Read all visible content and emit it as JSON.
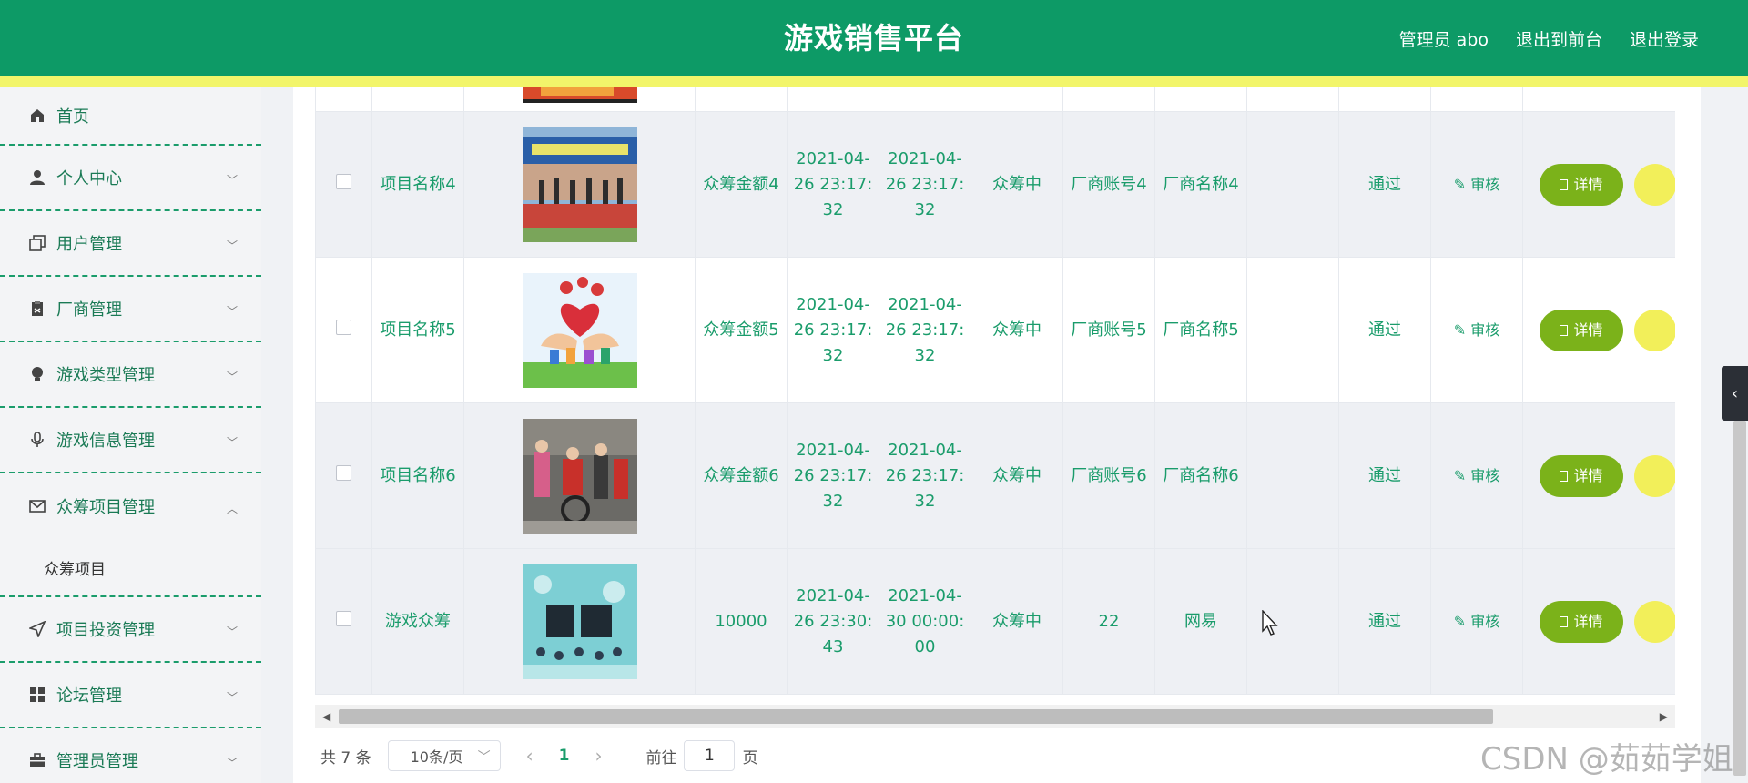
{
  "header": {
    "title": "游戏销售平台",
    "admin": "管理员 abo",
    "to_front": "退出到前台",
    "logout": "退出登录"
  },
  "sidebar": {
    "items": [
      {
        "label": "首页",
        "icon": "home-icon"
      },
      {
        "label": "个人中心",
        "icon": "user-icon"
      },
      {
        "label": "用户管理",
        "icon": "copy-icon"
      },
      {
        "label": "厂商管理",
        "icon": "clipboard-icon"
      },
      {
        "label": "游戏类型管理",
        "icon": "bulb-icon"
      },
      {
        "label": "游戏信息管理",
        "icon": "mic-icon"
      },
      {
        "label": "众筹项目管理",
        "icon": "mail-icon"
      },
      {
        "label": "项目投资管理",
        "icon": "navigation-icon"
      },
      {
        "label": "论坛管理",
        "icon": "grid-icon"
      },
      {
        "label": "管理员管理",
        "icon": "briefcase-icon"
      }
    ],
    "submenu_label": "众筹项目"
  },
  "table": {
    "rows": [
      {
        "name": "项目名称4",
        "amount": "众筹金额4",
        "start": "2021-04-26 23:17:32",
        "end": "2021-04-26 23:17:32",
        "status": "众筹中",
        "account": "厂商账号4",
        "vendor": "厂商名称4",
        "blank": "",
        "review": "通过",
        "audit": "审核",
        "detail": "详情",
        "image": "crowd-banner-image"
      },
      {
        "name": "项目名称5",
        "amount": "众筹金额5",
        "start": "2021-04-26 23:17:32",
        "end": "2021-04-26 23:17:32",
        "status": "众筹中",
        "account": "厂商账号5",
        "vendor": "厂商名称5",
        "blank": "",
        "review": "通过",
        "audit": "审核",
        "detail": "详情",
        "image": "hearts-hands-image"
      },
      {
        "name": "项目名称6",
        "amount": "众筹金额6",
        "start": "2021-04-26 23:17:32",
        "end": "2021-04-26 23:17:32",
        "status": "众筹中",
        "account": "厂商账号6",
        "vendor": "厂商名称6",
        "blank": "",
        "review": "通过",
        "audit": "审核",
        "detail": "详情",
        "image": "volunteers-image"
      },
      {
        "name": "游戏众筹",
        "amount": "10000",
        "start": "2021-04-26 23:30:43",
        "end": "2021-04-30 00:00:00",
        "status": "众筹中",
        "account": "22",
        "vendor": "网易",
        "blank": "",
        "review": "通过",
        "audit": "审核",
        "detail": "详情",
        "image": "crowdfunding-text-image"
      }
    ]
  },
  "pager": {
    "total": "共 7 条",
    "page_size": "10条/页",
    "current": "1",
    "goto_label": "前往",
    "goto_value": "1",
    "page_unit": "页"
  },
  "watermark": "CSDN @茹茹学姐",
  "colors": {
    "header": "#0d9a66",
    "accent_yellow": "#f2f56a",
    "text_green": "#1a9c6b",
    "detail_button": "#7bb21a"
  }
}
